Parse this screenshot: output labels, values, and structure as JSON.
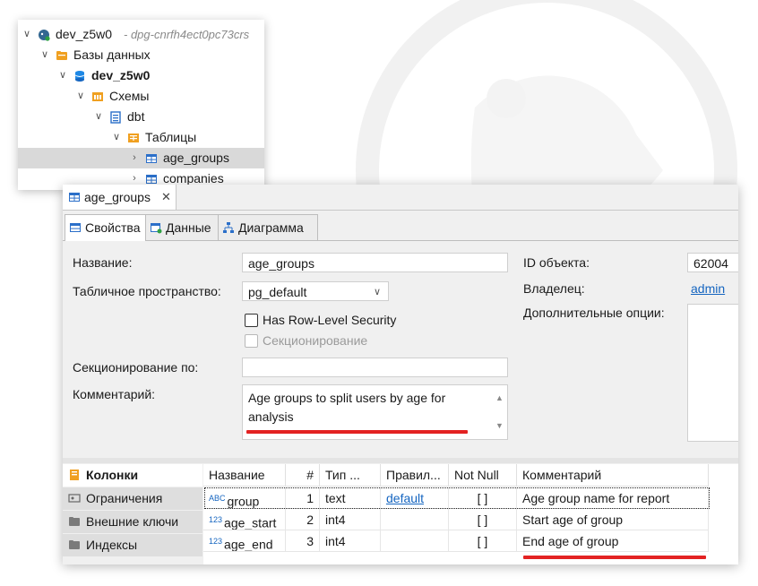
{
  "navigator": {
    "connection": {
      "name": "dev_z5w0",
      "host": "- dpg-cnrfh4ect0pc73crs"
    },
    "databases_label": "Базы данных",
    "database": "dev_z5w0",
    "schemas_label": "Схемы",
    "schema": "dbt",
    "tables_label": "Таблицы",
    "tables": [
      "age_groups",
      "companies"
    ]
  },
  "editor": {
    "tab_title": "age_groups",
    "close_glyph": "✕",
    "subtabs": [
      "Свойства",
      "Данные",
      "Диаграмма"
    ],
    "props": {
      "name_label": "Название:",
      "name_value": "age_groups",
      "tablespace_label": "Табличное пространство:",
      "tablespace_value": "pg_default",
      "rls_label": "Has Row-Level Security",
      "partitioning_label": "Секционирование",
      "partition_by_label": "Секционирование по:",
      "partition_by_value": "",
      "comment_label": "Комментарий:",
      "comment_value": "Age groups to split users by age for analysis",
      "object_id_label": "ID объекта:",
      "object_id_value": "62004",
      "owner_label": "Владелец:",
      "owner_value": "admin",
      "extra_label": "Дополнительные опции:"
    },
    "sections": [
      "Колонки",
      "Ограничения",
      "Внешние ключи",
      "Индексы"
    ],
    "columns_table": {
      "headers": [
        "Название",
        "#",
        "Тип ...",
        "Правил...",
        "Not Null",
        "Комментарий"
      ],
      "rows": [
        {
          "badge": "ABC",
          "name": "group",
          "num": "1",
          "type": "text",
          "rule": "default",
          "notnull": "[ ]",
          "comment": "Age group name for report"
        },
        {
          "badge": "123",
          "name": "age_start",
          "num": "2",
          "type": "int4",
          "rule": "",
          "notnull": "[ ]",
          "comment": "Start age of group"
        },
        {
          "badge": "123",
          "name": "age_end",
          "num": "3",
          "type": "int4",
          "rule": "",
          "notnull": "[ ]",
          "comment": "End age of group"
        }
      ]
    }
  },
  "colors": {
    "accent_blue": "#1565c0",
    "highlight_red": "#e32222",
    "table_icon_blue": "#2b6fc9",
    "folder_orange": "#f0a020"
  }
}
